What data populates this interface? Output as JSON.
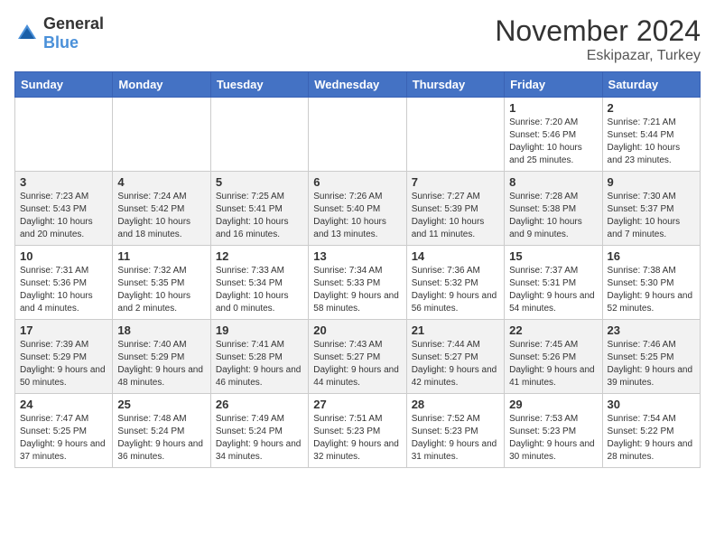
{
  "logo": {
    "text_general": "General",
    "text_blue": "Blue"
  },
  "header": {
    "month": "November 2024",
    "location": "Eskipazar, Turkey"
  },
  "weekdays": [
    "Sunday",
    "Monday",
    "Tuesday",
    "Wednesday",
    "Thursday",
    "Friday",
    "Saturday"
  ],
  "weeks": [
    [
      {
        "day": "",
        "info": ""
      },
      {
        "day": "",
        "info": ""
      },
      {
        "day": "",
        "info": ""
      },
      {
        "day": "",
        "info": ""
      },
      {
        "day": "",
        "info": ""
      },
      {
        "day": "1",
        "info": "Sunrise: 7:20 AM\nSunset: 5:46 PM\nDaylight: 10 hours and 25 minutes."
      },
      {
        "day": "2",
        "info": "Sunrise: 7:21 AM\nSunset: 5:44 PM\nDaylight: 10 hours and 23 minutes."
      }
    ],
    [
      {
        "day": "3",
        "info": "Sunrise: 7:23 AM\nSunset: 5:43 PM\nDaylight: 10 hours and 20 minutes."
      },
      {
        "day": "4",
        "info": "Sunrise: 7:24 AM\nSunset: 5:42 PM\nDaylight: 10 hours and 18 minutes."
      },
      {
        "day": "5",
        "info": "Sunrise: 7:25 AM\nSunset: 5:41 PM\nDaylight: 10 hours and 16 minutes."
      },
      {
        "day": "6",
        "info": "Sunrise: 7:26 AM\nSunset: 5:40 PM\nDaylight: 10 hours and 13 minutes."
      },
      {
        "day": "7",
        "info": "Sunrise: 7:27 AM\nSunset: 5:39 PM\nDaylight: 10 hours and 11 minutes."
      },
      {
        "day": "8",
        "info": "Sunrise: 7:28 AM\nSunset: 5:38 PM\nDaylight: 10 hours and 9 minutes."
      },
      {
        "day": "9",
        "info": "Sunrise: 7:30 AM\nSunset: 5:37 PM\nDaylight: 10 hours and 7 minutes."
      }
    ],
    [
      {
        "day": "10",
        "info": "Sunrise: 7:31 AM\nSunset: 5:36 PM\nDaylight: 10 hours and 4 minutes."
      },
      {
        "day": "11",
        "info": "Sunrise: 7:32 AM\nSunset: 5:35 PM\nDaylight: 10 hours and 2 minutes."
      },
      {
        "day": "12",
        "info": "Sunrise: 7:33 AM\nSunset: 5:34 PM\nDaylight: 10 hours and 0 minutes."
      },
      {
        "day": "13",
        "info": "Sunrise: 7:34 AM\nSunset: 5:33 PM\nDaylight: 9 hours and 58 minutes."
      },
      {
        "day": "14",
        "info": "Sunrise: 7:36 AM\nSunset: 5:32 PM\nDaylight: 9 hours and 56 minutes."
      },
      {
        "day": "15",
        "info": "Sunrise: 7:37 AM\nSunset: 5:31 PM\nDaylight: 9 hours and 54 minutes."
      },
      {
        "day": "16",
        "info": "Sunrise: 7:38 AM\nSunset: 5:30 PM\nDaylight: 9 hours and 52 minutes."
      }
    ],
    [
      {
        "day": "17",
        "info": "Sunrise: 7:39 AM\nSunset: 5:29 PM\nDaylight: 9 hours and 50 minutes."
      },
      {
        "day": "18",
        "info": "Sunrise: 7:40 AM\nSunset: 5:29 PM\nDaylight: 9 hours and 48 minutes."
      },
      {
        "day": "19",
        "info": "Sunrise: 7:41 AM\nSunset: 5:28 PM\nDaylight: 9 hours and 46 minutes."
      },
      {
        "day": "20",
        "info": "Sunrise: 7:43 AM\nSunset: 5:27 PM\nDaylight: 9 hours and 44 minutes."
      },
      {
        "day": "21",
        "info": "Sunrise: 7:44 AM\nSunset: 5:27 PM\nDaylight: 9 hours and 42 minutes."
      },
      {
        "day": "22",
        "info": "Sunrise: 7:45 AM\nSunset: 5:26 PM\nDaylight: 9 hours and 41 minutes."
      },
      {
        "day": "23",
        "info": "Sunrise: 7:46 AM\nSunset: 5:25 PM\nDaylight: 9 hours and 39 minutes."
      }
    ],
    [
      {
        "day": "24",
        "info": "Sunrise: 7:47 AM\nSunset: 5:25 PM\nDaylight: 9 hours and 37 minutes."
      },
      {
        "day": "25",
        "info": "Sunrise: 7:48 AM\nSunset: 5:24 PM\nDaylight: 9 hours and 36 minutes."
      },
      {
        "day": "26",
        "info": "Sunrise: 7:49 AM\nSunset: 5:24 PM\nDaylight: 9 hours and 34 minutes."
      },
      {
        "day": "27",
        "info": "Sunrise: 7:51 AM\nSunset: 5:23 PM\nDaylight: 9 hours and 32 minutes."
      },
      {
        "day": "28",
        "info": "Sunrise: 7:52 AM\nSunset: 5:23 PM\nDaylight: 9 hours and 31 minutes."
      },
      {
        "day": "29",
        "info": "Sunrise: 7:53 AM\nSunset: 5:23 PM\nDaylight: 9 hours and 30 minutes."
      },
      {
        "day": "30",
        "info": "Sunrise: 7:54 AM\nSunset: 5:22 PM\nDaylight: 9 hours and 28 minutes."
      }
    ]
  ]
}
